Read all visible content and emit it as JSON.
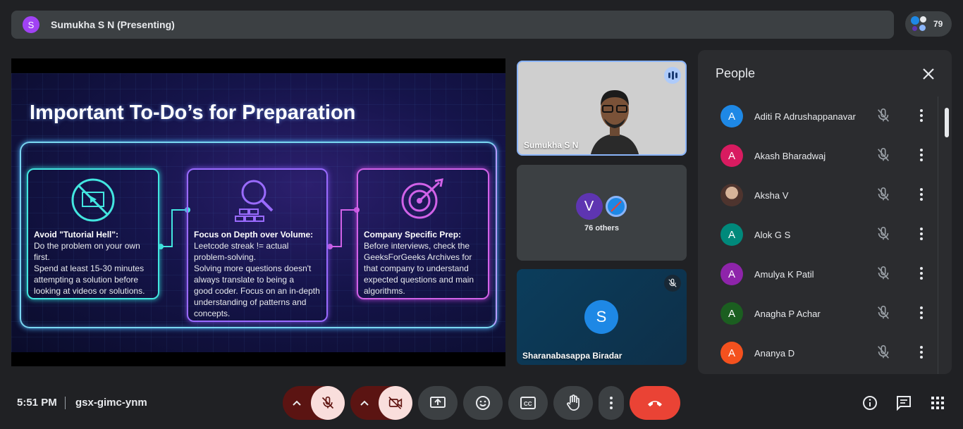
{
  "topbar": {
    "presenter_initial": "S",
    "title": "Sumukha S N (Presenting)"
  },
  "participant_count": "79",
  "slide": {
    "title": "Important To-Do’s for Preparation",
    "cards": [
      {
        "title": "Avoid \"Tutorial Hell\":",
        "text": "Do the problem on your own\nfirst.\nSpend at least 15-30 minutes\nattempting a solution before\nlooking at videos or solutions."
      },
      {
        "title": "Focus on Depth over Volume:",
        "text": "Leetcode streak != actual\nproblem-solving.\nSolving more questions doesn't\nalways translate to being a\ngood coder. Focus on an in-depth\nunderstanding of patterns and\nconcepts."
      },
      {
        "title": "Company Specific Prep:",
        "text": "Before interviews, check the\nGeeksForGeeks Archives for\nthat company to understand\nexpected questions and main\nalgorithms."
      }
    ]
  },
  "tiles": {
    "speaker": {
      "name": "Sumukha S N"
    },
    "others": {
      "initial": "V",
      "label": "76 others"
    },
    "third": {
      "initial": "S",
      "name": "Sharanabasappa Biradar"
    }
  },
  "people_panel": {
    "title": "People",
    "participants": [
      {
        "initial": "A",
        "name": "Aditi R Adrushappanavar",
        "color": "#1e88e5"
      },
      {
        "initial": "A",
        "name": "Akash Bharadwaj",
        "color": "#d81b60"
      },
      {
        "initial": "",
        "name": "Aksha V",
        "color": "#8d6e63"
      },
      {
        "initial": "A",
        "name": "Alok G S",
        "color": "#00897b"
      },
      {
        "initial": "A",
        "name": "Amulya K Patil",
        "color": "#8e24aa"
      },
      {
        "initial": "A",
        "name": "Anagha P Achar",
        "color": "#1b5e20"
      },
      {
        "initial": "A",
        "name": "Ananya D",
        "color": "#f4511e"
      }
    ]
  },
  "bottombar": {
    "time": "5:51 PM",
    "meeting_code": "gsx-gimc-ynm"
  }
}
